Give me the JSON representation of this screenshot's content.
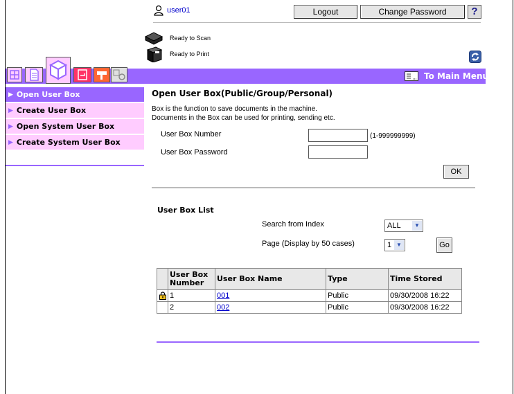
{
  "header": {
    "username": "user01",
    "logout_label": "Logout",
    "change_password_label": "Change Password",
    "help_label": "?",
    "status_scan": "Ready to Scan",
    "status_print": "Ready to Print",
    "to_main_menu": "To Main Menu"
  },
  "sidebar": {
    "items": [
      {
        "label": "Open User Box",
        "active": true
      },
      {
        "label": "Create User Box",
        "active": false
      },
      {
        "label": "Open System User Box",
        "active": false
      },
      {
        "label": "Create System User Box",
        "active": false
      }
    ]
  },
  "open_box": {
    "title": "Open User Box(Public/Group/Personal)",
    "desc_line1": "Box is the function to save documents in the machine.",
    "desc_line2": "Documents in the Box can be used for printing, sending etc.",
    "number_label": "User Box Number",
    "password_label": "User Box Password",
    "number_value": "",
    "password_value": "",
    "range_hint": "(1-999999999)",
    "ok_label": "OK"
  },
  "box_list": {
    "title": "User Box List",
    "search_label": "Search from Index",
    "search_value": "ALL",
    "page_label": "Page (Display by 50 cases)",
    "page_value": "1",
    "go_label": "Go",
    "columns": [
      "User Box Number",
      "User Box Name",
      "Type",
      "Time Stored"
    ],
    "rows": [
      {
        "locked": true,
        "number": "1",
        "name": "001",
        "type": "Public",
        "time": "09/30/2008 16:22"
      },
      {
        "locked": false,
        "number": "2",
        "name": "002",
        "type": "Public",
        "time": "09/30/2008 16:22"
      }
    ]
  },
  "colors": {
    "accent": "#9966ff",
    "sidebar_bg": "#ffccff",
    "link": "#0000cc"
  }
}
